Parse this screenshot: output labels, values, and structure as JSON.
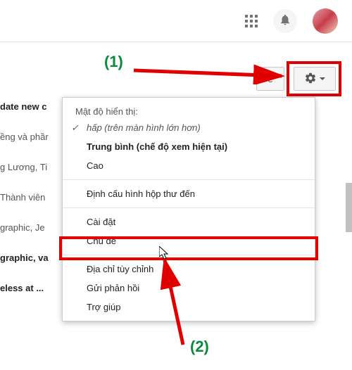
{
  "topbar": {
    "apps_icon": "apps-icon",
    "bell_icon": "bell-icon",
    "avatar": "avatar"
  },
  "annotations": {
    "label1": "(1)",
    "label2": "(2)"
  },
  "buttons": {
    "extra_label": "ê",
    "gear": "gear-icon"
  },
  "menu": {
    "section_title": "Mật độ hiển thị:",
    "items": [
      {
        "label": "hấp (trên màn hình lớn hơn)",
        "style": "check sub"
      },
      {
        "label": "Trung bình (chế độ xem hiện tại)",
        "style": "bold"
      },
      {
        "label": "Cao",
        "style": ""
      }
    ],
    "group2": [
      {
        "label": "Định cấu hình hộp thư đến"
      }
    ],
    "group3": [
      {
        "label": "Cài đặt"
      },
      {
        "label": "Chủ đề"
      }
    ],
    "group4": [
      {
        "label": "Địa chỉ tùy chỉnh"
      },
      {
        "label": "Gửi phản hồi"
      },
      {
        "label": "Trợ giúp"
      }
    ]
  },
  "bg_list": {
    "items": [
      "date new c",
      "ềng và phầr",
      "g Lương, Ti",
      "Thành viên",
      "graphic, Je",
      "graphic, va",
      "eless at ..."
    ],
    "bold_rows": [
      0,
      5,
      6
    ]
  }
}
